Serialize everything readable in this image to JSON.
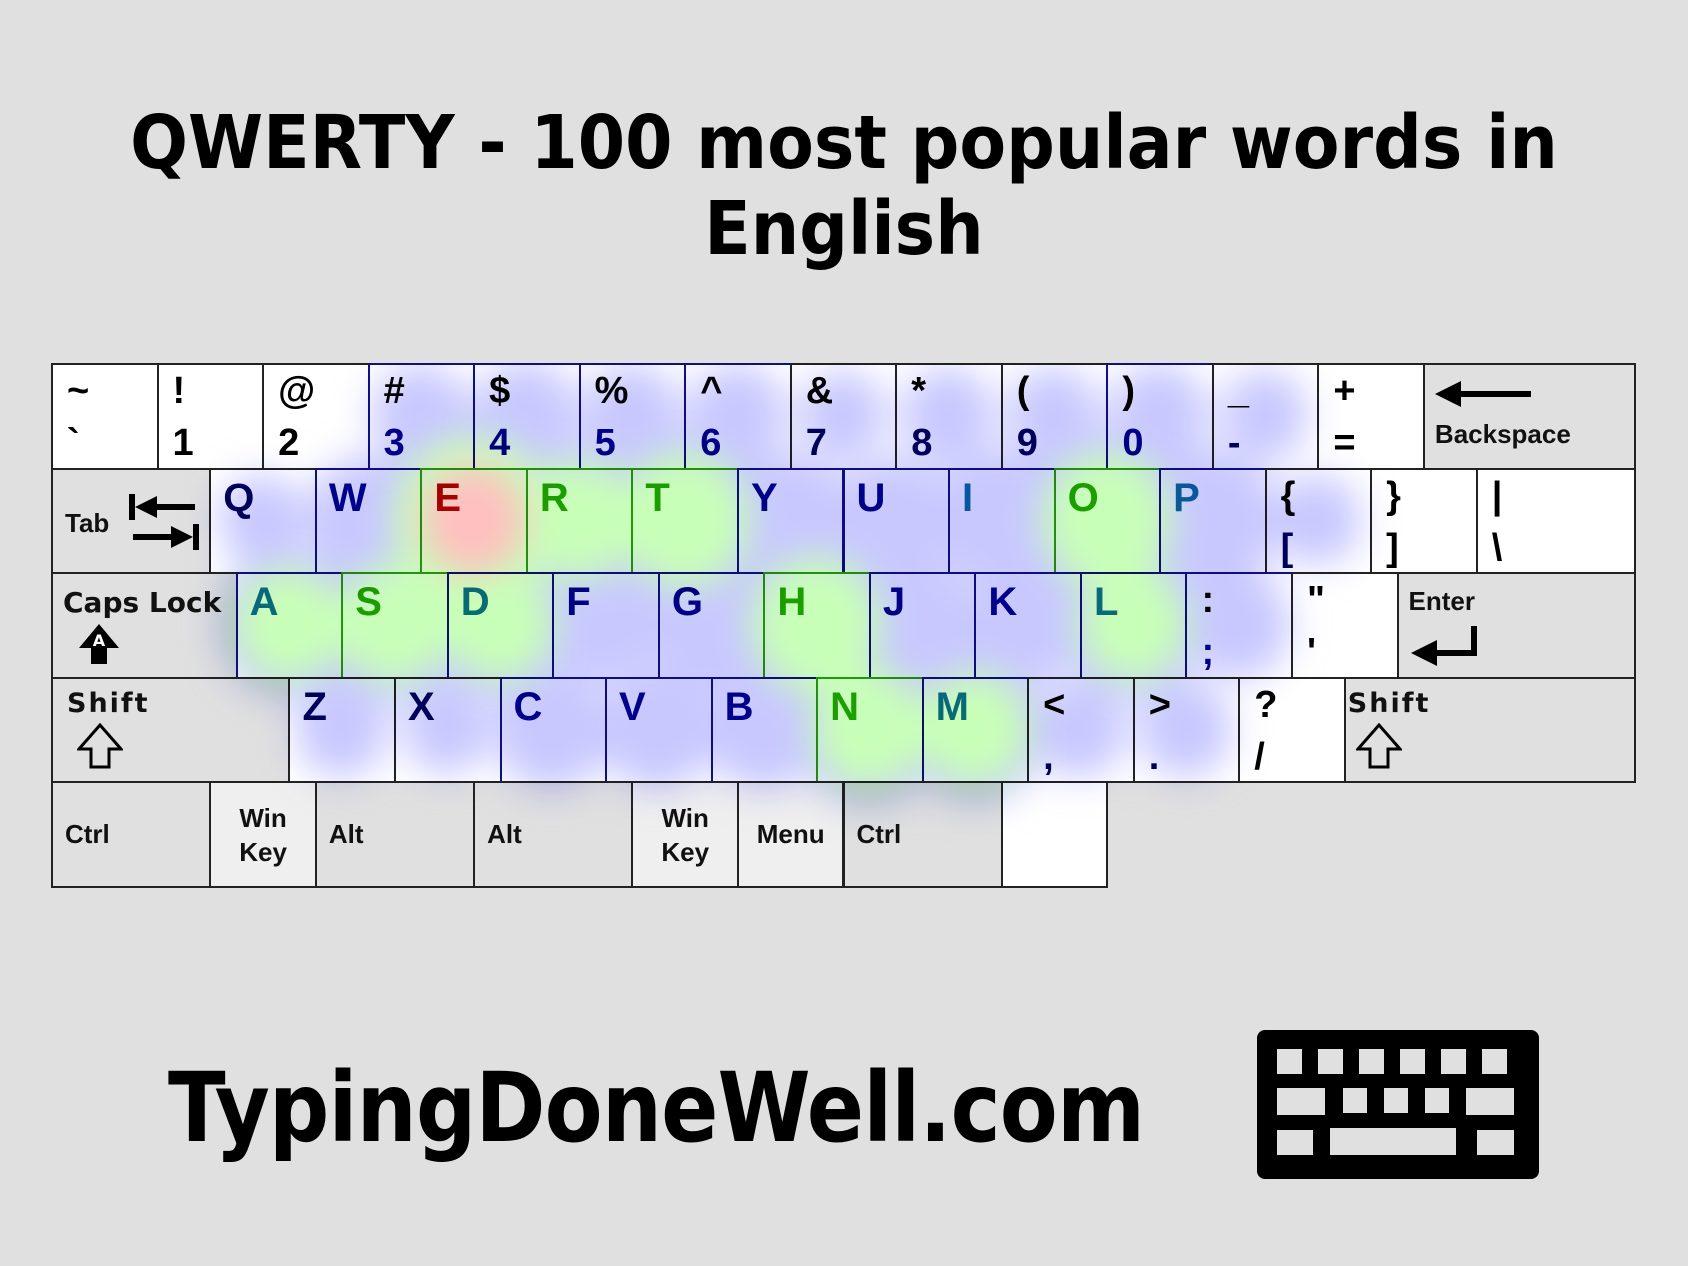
{
  "title": "QWERTY - 100 most popular words in English",
  "footer": {
    "site": "TypingDoneWell.com",
    "logo_icon": "keyboard-icon"
  },
  "colors": {
    "background": "#e0e0e0",
    "key_face": "#ffffff",
    "modifier_face": "#e0e0e0",
    "modifier_light_face": "#efefef",
    "heat_low": "#c8c8ff",
    "heat_mid": "#c8ffb8",
    "heat_high": "#ffc0c0",
    "text_low": "#00008c",
    "text_mid": "#22a000",
    "text_high": "#b00000"
  },
  "legend": {
    "low": "blue",
    "medium": "green",
    "high": "red"
  },
  "rows": [
    [
      {
        "id": "backtick",
        "up": "~",
        "low": "`",
        "w": 1,
        "heat": 0
      },
      {
        "id": "1",
        "up": "!",
        "low": "1",
        "w": 1,
        "heat": 0
      },
      {
        "id": "2",
        "up": "@",
        "low": "2",
        "w": 1,
        "heat": 0
      },
      {
        "id": "3",
        "up": "#",
        "low": "3",
        "w": 1,
        "heat": 0.15
      },
      {
        "id": "4",
        "up": "$",
        "low": "4",
        "w": 1,
        "heat": 0.2
      },
      {
        "id": "5",
        "up": "%",
        "low": "5",
        "w": 1,
        "heat": 0.15
      },
      {
        "id": "6",
        "up": "^",
        "low": "6",
        "w": 1,
        "heat": 0.15
      },
      {
        "id": "7",
        "up": "&",
        "low": "7",
        "w": 1,
        "heat": 0.05
      },
      {
        "id": "8",
        "up": "*",
        "low": "8",
        "w": 1,
        "heat": 0.1
      },
      {
        "id": "9",
        "up": "(",
        "low": "9",
        "w": 1,
        "heat": 0.1
      },
      {
        "id": "0",
        "up": ")",
        "low": "0",
        "w": 1,
        "heat": 0.15
      },
      {
        "id": "minus",
        "up": "_",
        "low": "-",
        "w": 1,
        "heat": 0.05
      },
      {
        "id": "equals",
        "up": "+",
        "low": "=",
        "w": 1,
        "heat": 0
      },
      {
        "id": "backspace",
        "label": "Backspace",
        "w": 2,
        "mod": true,
        "icon": "backspace-arrow-icon"
      }
    ],
    [
      {
        "id": "tab",
        "label": "Tab",
        "w": 1.5,
        "mod": true,
        "icon": "tab-arrows-icon"
      },
      {
        "id": "q",
        "main": "Q",
        "w": 1,
        "heat": 0.05
      },
      {
        "id": "w",
        "main": "W",
        "w": 1,
        "heat": 0.35
      },
      {
        "id": "e",
        "main": "E",
        "w": 1,
        "heat": 1.0
      },
      {
        "id": "r",
        "main": "R",
        "w": 1,
        "heat": 0.55
      },
      {
        "id": "t",
        "main": "T",
        "w": 1,
        "heat": 0.7
      },
      {
        "id": "y",
        "main": "Y",
        "w": 1,
        "heat": 0.4
      },
      {
        "id": "u",
        "main": "U",
        "w": 1,
        "heat": 0.35
      },
      {
        "id": "i",
        "main": "I",
        "w": 1,
        "heat": 0.45
      },
      {
        "id": "o",
        "main": "O",
        "w": 1,
        "heat": 0.7
      },
      {
        "id": "p",
        "main": "P",
        "w": 1,
        "heat": 0.45
      },
      {
        "id": "lbracket",
        "up": "{",
        "low": "[",
        "w": 1,
        "heat": 0.05
      },
      {
        "id": "rbracket",
        "up": "}",
        "low": "]",
        "w": 1,
        "heat": 0
      },
      {
        "id": "backslash",
        "up": "|",
        "low": "\\",
        "w": 1.5,
        "heat": 0
      }
    ],
    [
      {
        "id": "capslock",
        "label": "Caps Lock",
        "w": 1.75,
        "mod": true,
        "icon": "caps-lock-icon"
      },
      {
        "id": "a",
        "main": "A",
        "w": 1,
        "heat": 0.5
      },
      {
        "id": "s",
        "main": "S",
        "w": 1,
        "heat": 0.55
      },
      {
        "id": "d",
        "main": "D",
        "w": 1,
        "heat": 0.5
      },
      {
        "id": "f",
        "main": "F",
        "w": 1,
        "heat": 0.25
      },
      {
        "id": "g",
        "main": "G",
        "w": 1,
        "heat": 0.4
      },
      {
        "id": "h",
        "main": "H",
        "w": 1,
        "heat": 0.7
      },
      {
        "id": "j",
        "main": "J",
        "w": 1,
        "heat": 0.3
      },
      {
        "id": "k",
        "main": "K",
        "w": 1,
        "heat": 0.3
      },
      {
        "id": "l",
        "main": "L",
        "w": 1,
        "heat": 0.5
      },
      {
        "id": "semicolon",
        "up": ":",
        "low": ";",
        "w": 1,
        "heat": 0.2
      },
      {
        "id": "quote",
        "up": "\"",
        "low": "'",
        "w": 1,
        "heat": 0
      },
      {
        "id": "enter",
        "label": "Enter",
        "w": 2.25,
        "mod": true,
        "icon": "enter-arrow-icon"
      }
    ],
    [
      {
        "id": "lshift",
        "label": "Shift",
        "w": 2.25,
        "mod": true,
        "icon": "shift-arrow-icon"
      },
      {
        "id": "z",
        "main": "Z",
        "w": 1,
        "heat": 0.1
      },
      {
        "id": "x",
        "main": "X",
        "w": 1,
        "heat": 0.05
      },
      {
        "id": "c",
        "main": "C",
        "w": 1,
        "heat": 0.3
      },
      {
        "id": "v",
        "main": "V",
        "w": 1,
        "heat": 0.3
      },
      {
        "id": "b",
        "main": "B",
        "w": 1,
        "heat": 0.3
      },
      {
        "id": "n",
        "main": "N",
        "w": 1,
        "heat": 0.55
      },
      {
        "id": "m",
        "main": "M",
        "w": 1,
        "heat": 0.5
      },
      {
        "id": "comma",
        "up": "<",
        "low": ",",
        "w": 1,
        "heat": 0.1
      },
      {
        "id": "period",
        "up": ">",
        "low": ".",
        "w": 1,
        "heat": 0.1
      },
      {
        "id": "slash",
        "up": "?",
        "low": "/",
        "w": 1,
        "heat": 0
      },
      {
        "id": "rshift",
        "label": "Shift",
        "w": 2.75,
        "mod": true,
        "icon": "shift-arrow-icon"
      }
    ],
    [
      {
        "id": "lctrl",
        "label": "Ctrl",
        "w": 1.5,
        "mod": true
      },
      {
        "id": "lwin",
        "label": "Win Key",
        "w": 1,
        "mod2": true
      },
      {
        "id": "lalt",
        "label": "Alt",
        "w": 1.5,
        "mod": true
      },
      {
        "id": "space",
        "label": "",
        "w": 6,
        "heat": 0.05
      },
      {
        "id": "ralt",
        "label": "Alt",
        "w": 1.5,
        "mod": true
      },
      {
        "id": "rwin",
        "label": "Win Key",
        "w": 1,
        "mod2": true
      },
      {
        "id": "menu",
        "label": "Menu",
        "w": 1,
        "mod2": true
      },
      {
        "id": "rctrl",
        "label": "Ctrl",
        "w": 1.5,
        "mod": true
      }
    ]
  ]
}
